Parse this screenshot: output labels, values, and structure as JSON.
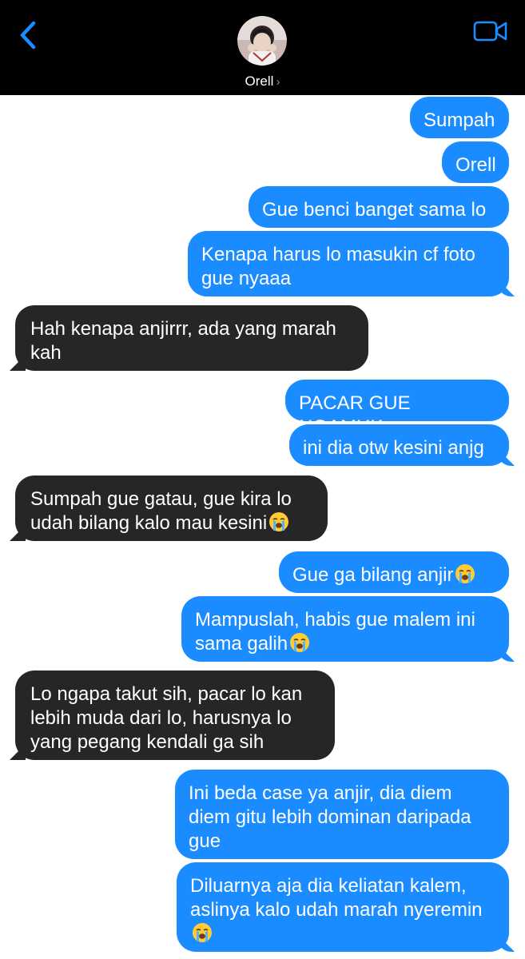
{
  "header": {
    "contact_name": "Orell",
    "chevron": "›",
    "icons": {
      "back": "chevron-left-icon",
      "video": "video-camera-icon",
      "avatar": "avatar"
    },
    "accent_color": "#1a8cff"
  },
  "colors": {
    "outgoing_bubble": "#1a8cff",
    "incoming_bubble": "#262628",
    "header_bg": "#000000",
    "screen_bg": "#ffffff"
  },
  "messages": [
    {
      "side": "out",
      "text": "Sumpah"
    },
    {
      "side": "out",
      "text": "Orell"
    },
    {
      "side": "out",
      "text": "Gue benci banget sama lo"
    },
    {
      "side": "out",
      "text": "Kenapa harus lo masukin cf foto gue nyaaa"
    },
    {
      "side": "in",
      "text": "Hah kenapa anjirrr, ada yang marah kah"
    },
    {
      "side": "out",
      "text": "PACAR GUE NGAMUK"
    },
    {
      "side": "out",
      "text": "ini dia otw kesini anjg"
    },
    {
      "side": "in",
      "text": "Sumpah gue gatau, gue kira lo udah bilang kalo mau kesini",
      "emoji": "loudly-crying-face"
    },
    {
      "side": "out",
      "text": "Gue ga bilang anjir",
      "emoji": "loudly-crying-face"
    },
    {
      "side": "out",
      "text": "Mampuslah, habis gue malem ini sama galih",
      "emoji": "loudly-crying-face"
    },
    {
      "side": "in",
      "text": "Lo ngapa takut sih, pacar lo kan lebih muda dari lo, harusnya lo yang pegang kendali ga sih"
    },
    {
      "side": "out",
      "text": "Ini beda case ya anjir, dia diem diem gitu lebih dominan daripada gue"
    },
    {
      "side": "out",
      "text": "Diluarnya aja dia keliatan kalem, aslinya kalo udah marah nyeremin",
      "emoji": "loudly-crying-face"
    }
  ]
}
